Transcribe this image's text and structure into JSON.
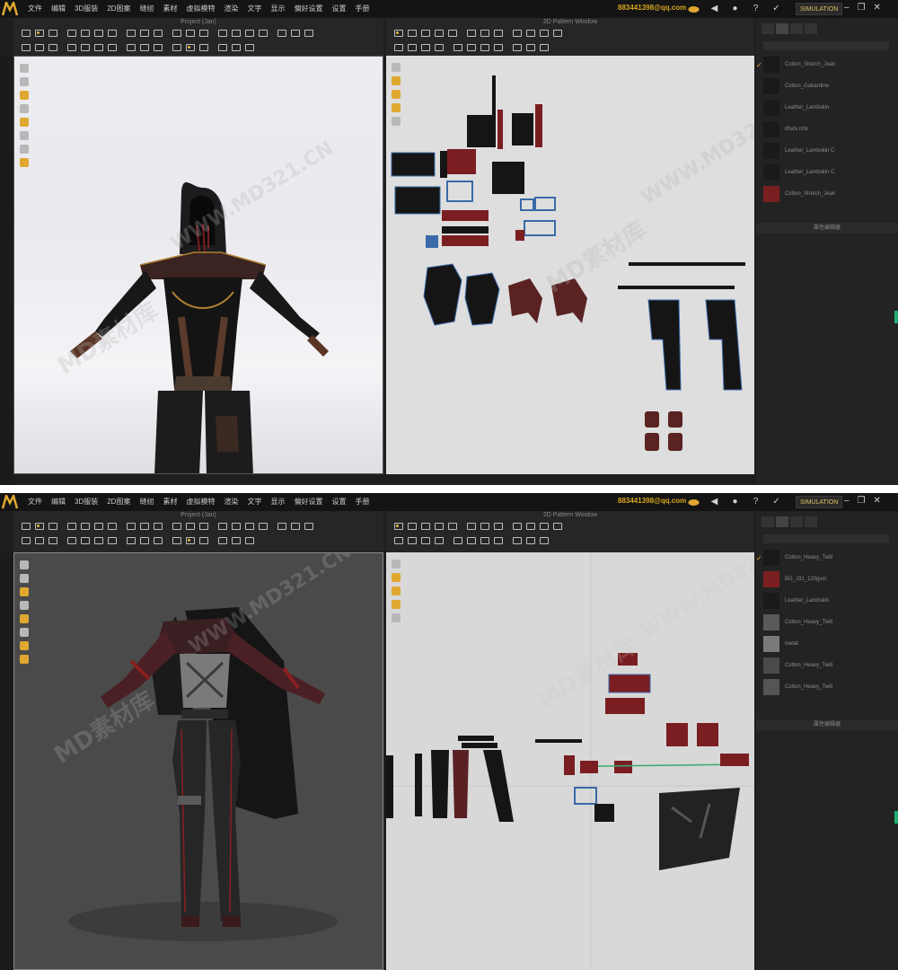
{
  "menubar": {
    "items": [
      "文件",
      "编辑",
      "3D服装",
      "2D图案",
      "缝纫",
      "素材",
      "虚拟模特",
      "渲染",
      "文字",
      "显示",
      "偏好设置",
      "设置",
      "手册"
    ],
    "account": "883441398@qq.com",
    "edition": "SIMULATION"
  },
  "top_window": {
    "view3d_title": "Project (Jan)",
    "view2d_title": "2D Pattern Window",
    "materials": [
      "Cotton_Stretch_Jean",
      "Cotton_Gabardine",
      "Leather_Lambskin",
      "dfsdv nrtx",
      "Leather_Lambskin C",
      "Leather_Lambskin C",
      "Cotton_Stretch_Jean"
    ],
    "panel_footer": "属性编辑器"
  },
  "bottom_window": {
    "view3d_title": "Project (Jan)",
    "view2d_title": "2D Pattern Window",
    "materials": [
      "Cotton_Heavy_Twill",
      "BG_J31_120gsm",
      "Leather_Lambskin",
      "Cotton_Heavy_Twill",
      "metal",
      "Cotton_Heavy_Twill",
      "Cotton_Heavy_Twill"
    ],
    "panel_footer": "属性编辑器"
  },
  "watermarks": [
    "WWW.MD321.CN",
    "MD素材库",
    "WWW.MD321.CN",
    "MD素材库"
  ],
  "colors": {
    "accent": "#e0a830",
    "panel": "#232323",
    "menubar": "#141414",
    "fabric_red": "#7a1e22"
  },
  "icons": [
    "logo-icon",
    "cloud-icon",
    "speaker-icon",
    "user-icon",
    "help-icon",
    "pin-icon",
    "minimize-icon",
    "restore-icon",
    "close-icon"
  ]
}
